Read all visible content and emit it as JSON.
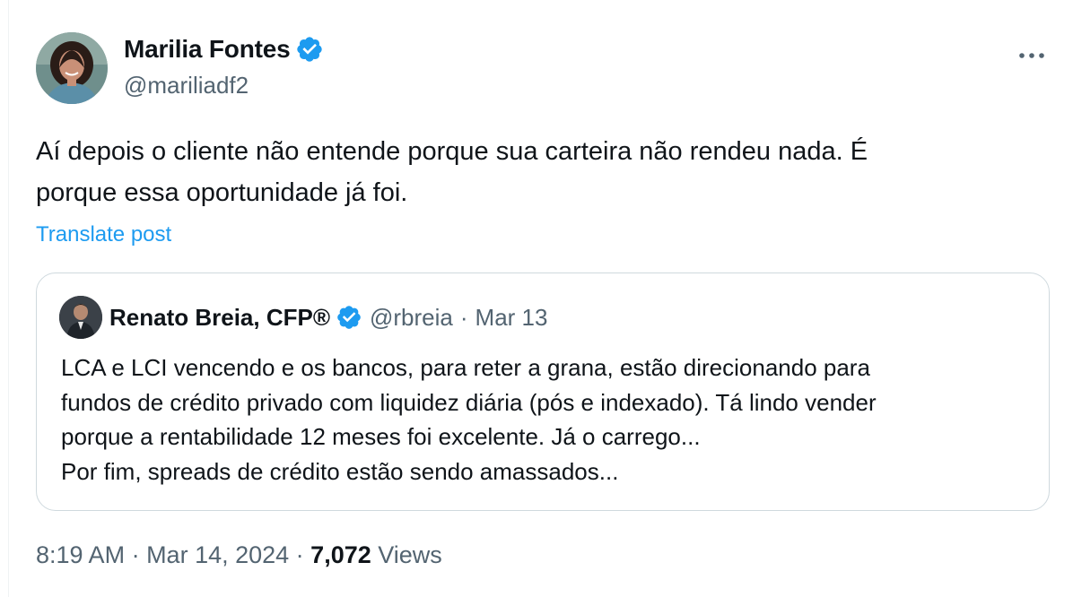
{
  "author": {
    "name": "Marilia Fontes",
    "handle": "@mariliadf2",
    "verified_color": "#1d9bf0"
  },
  "more_icon": "ellipsis-icon",
  "tweet": {
    "text_line1": "Aí depois o cliente não entende porque sua carteira não rendeu nada. É",
    "text_line2": "porque essa oportunidade já foi.",
    "translate_label": "Translate post"
  },
  "quoted": {
    "name": "Renato Breia, CFP®",
    "handle": "@rbreia",
    "separator": "·",
    "date": "Mar 13",
    "lines": [
      "LCA e LCI vencendo e os bancos, para reter a grana, estão direcionando para",
      "fundos de crédito privado com liquidez diária (pós e indexado). Tá lindo vender",
      "porque a rentabilidade 12 meses foi excelente. Já o carrego...",
      "Por fim, spreads de crédito estão sendo amassados..."
    ]
  },
  "meta": {
    "time": "8:19 AM",
    "separator": " · ",
    "date": "Mar 14, 2024",
    "views_count": "7,072",
    "views_label": " Views"
  },
  "colors": {
    "accent": "#1d9bf0",
    "text": "#0f1419",
    "secondary": "#536471",
    "border": "#cfd9de"
  }
}
